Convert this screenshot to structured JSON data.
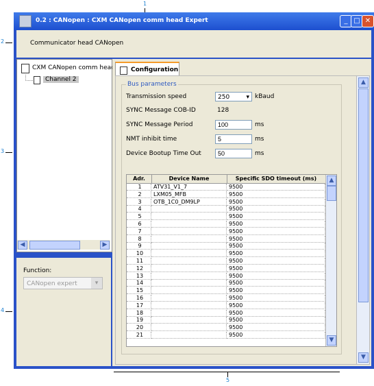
{
  "window": {
    "title": "0.2 : CANopen : CXM CANopen comm head Expert",
    "buttons": {
      "minimize": "_",
      "maximize": "□",
      "close": "✕"
    }
  },
  "header": {
    "text": "Communicator head CANopen"
  },
  "tree": {
    "root_label": "CXM CANopen comm head",
    "child_label": "Channel 2"
  },
  "function": {
    "label": "Function:",
    "value": "CANopen expert"
  },
  "tab": {
    "label": "Configuration"
  },
  "bus_parameters": {
    "title": "Bus parameters",
    "transmission_speed": {
      "label": "Transmission speed",
      "value": "250",
      "unit": "kBaud"
    },
    "sync_cob_id": {
      "label": "SYNC Message COB-ID",
      "value": "128"
    },
    "sync_period": {
      "label": "SYNC Message Period",
      "value": "100",
      "unit": "ms"
    },
    "nmt_inhibit": {
      "label": "NMT inhibit time",
      "value": "5",
      "unit": "ms"
    },
    "bootup_timeout": {
      "label": "Device Bootup Time Out",
      "value": "50",
      "unit": "ms"
    }
  },
  "table": {
    "headers": [
      "Adr.",
      "Device Name",
      "Specific SDO timeout (ms)"
    ],
    "rows": [
      [
        "1",
        "ATV31_V1_7",
        "9500"
      ],
      [
        "2",
        "LXM05_MFB",
        "9500"
      ],
      [
        "3",
        "OTB_1C0_DM9LP",
        "9500"
      ],
      [
        "4",
        "",
        "9500"
      ],
      [
        "5",
        "",
        "9500"
      ],
      [
        "6",
        "",
        "9500"
      ],
      [
        "7",
        "",
        "9500"
      ],
      [
        "8",
        "",
        "9500"
      ],
      [
        "9",
        "",
        "9500"
      ],
      [
        "10",
        "",
        "9500"
      ],
      [
        "11",
        "",
        "9500"
      ],
      [
        "12",
        "",
        "9500"
      ],
      [
        "13",
        "",
        "9500"
      ],
      [
        "14",
        "",
        "9500"
      ],
      [
        "15",
        "",
        "9500"
      ],
      [
        "16",
        "",
        "9500"
      ],
      [
        "17",
        "",
        "9500"
      ],
      [
        "18",
        "",
        "9500"
      ],
      [
        "19",
        "",
        "9500"
      ],
      [
        "20",
        "",
        "9500"
      ],
      [
        "21",
        "",
        "9500"
      ]
    ]
  },
  "callouts": [
    "1",
    "2",
    "3",
    "4",
    "5"
  ],
  "icons": {
    "scroll_up": "▲",
    "scroll_down": "▼",
    "scroll_left": "◀",
    "scroll_right": "▶",
    "dropdown": "▾"
  }
}
